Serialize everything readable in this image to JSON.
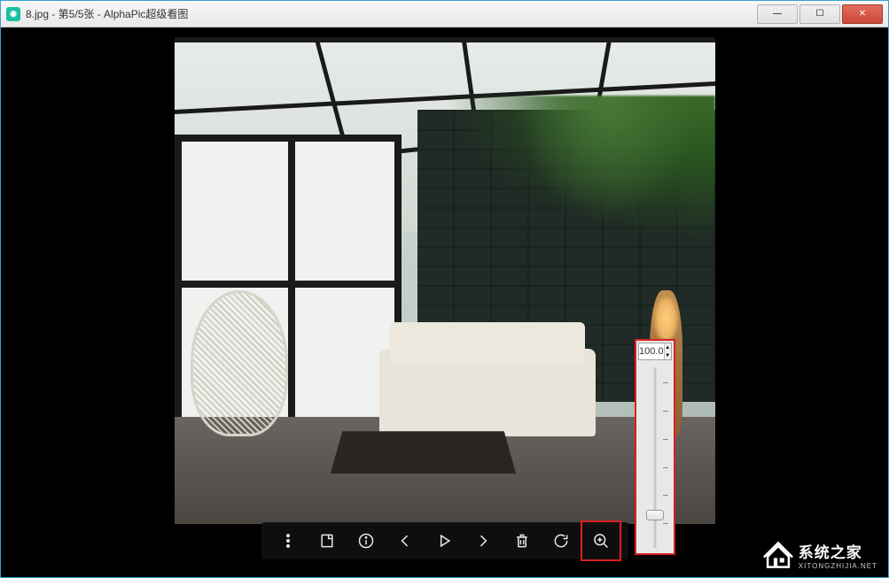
{
  "window": {
    "title": "8.jpg - 第5/5张 - AlphaPic超级看图",
    "app_icon_glyph": "▣"
  },
  "controls": {
    "minimize": "—",
    "maximize": "☐",
    "close": "✕"
  },
  "zoom": {
    "value": "100.0",
    "thumb_position_pct": 78
  },
  "toolbar": {
    "menu": "more-icon",
    "rotate": "rotate-note-icon",
    "info": "info-icon",
    "prev": "previous-icon",
    "play": "play-icon",
    "next": "next-icon",
    "delete": "trash-icon",
    "refresh": "refresh-icon",
    "zoomin": "zoom-in-icon"
  },
  "watermark": {
    "main": "系统之家",
    "sub": "XITONGZHIJIA.NET"
  }
}
